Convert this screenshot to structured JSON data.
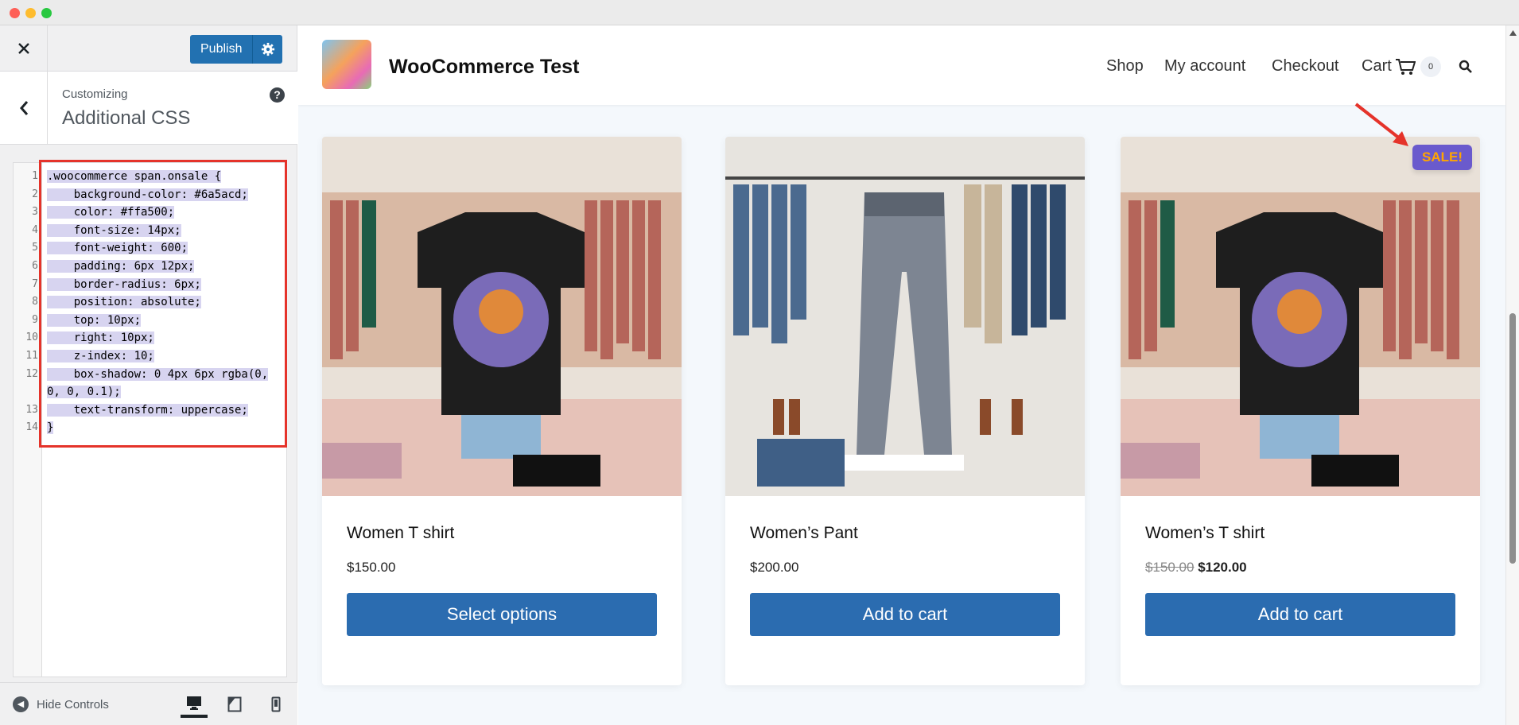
{
  "sidebar": {
    "publish_label": "Publish",
    "customizing_label": "Customizing",
    "section_title": "Additional CSS",
    "hide_controls_label": "Hide Controls",
    "code": {
      "line_numbers": [
        "1",
        "2",
        "3",
        "4",
        "5",
        "6",
        "7",
        "8",
        "9",
        "10",
        "11",
        "12",
        "",
        "13",
        "14"
      ],
      "lines": [
        ".woocommerce span.onsale {",
        "    background-color: #6a5acd;",
        "    color: #ffa500;",
        "    font-size: 14px;",
        "    font-weight: 600;",
        "    padding: 6px 12px;",
        "    border-radius: 6px;",
        "    position: absolute;",
        "    top: 10px;",
        "    right: 10px;",
        "    z-index: 10;",
        "    box-shadow: 0 4px 6px rgba(0,",
        "0, 0, 0.1);",
        "    text-transform: uppercase;",
        "}"
      ]
    }
  },
  "site": {
    "title": "WooCommerce Test",
    "nav": {
      "shop": "Shop",
      "account": "My account",
      "checkout": "Checkout",
      "cart": "Cart",
      "cart_count": "0"
    }
  },
  "products": [
    {
      "title": "Women T shirt",
      "price": "$150.00",
      "button": "Select options"
    },
    {
      "title": "Women’s Pant",
      "price": "$200.00",
      "button": "Add to cart"
    },
    {
      "title": "Women’s T shirt",
      "old_price": "$150.00",
      "sale_price": "$120.00",
      "button": "Add to cart",
      "badge": "SALE!"
    }
  ],
  "colors": {
    "accent": "#2271b1",
    "button": "#2b6cb0",
    "sale_bg": "#6a5acd",
    "sale_text": "#ffa500",
    "highlight_border": "#e5332a"
  }
}
